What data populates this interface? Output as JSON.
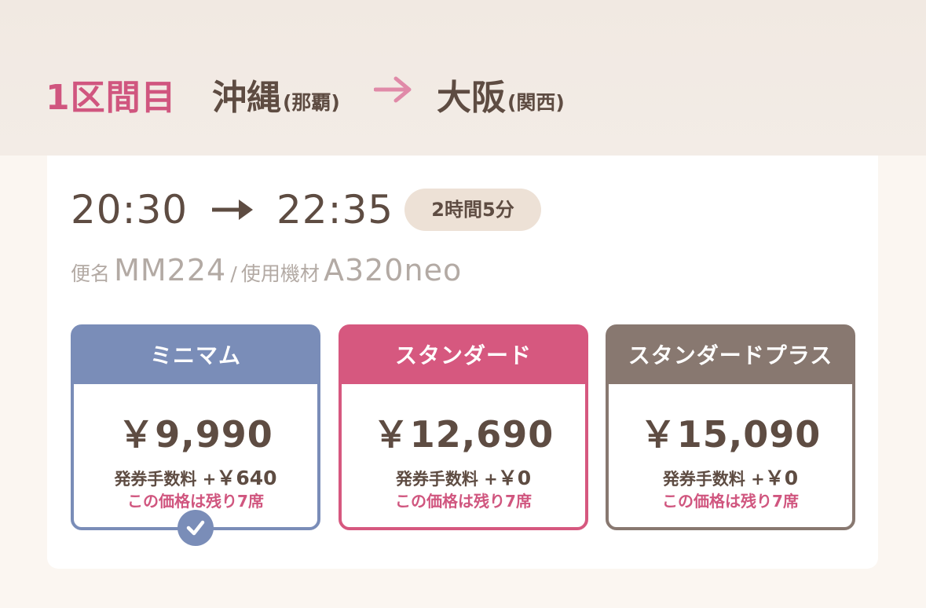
{
  "header": {
    "segment_label": "1区間目",
    "origin_city": "沖縄",
    "origin_airport": "(那覇)",
    "destination_city": "大阪",
    "destination_airport": "(関西)"
  },
  "flight": {
    "departure_time": "20:30",
    "arrival_time": "22:35",
    "duration": "2時間5分",
    "flight_no_label": "便名",
    "flight_no": "MM224",
    "separator": "/",
    "aircraft_label": "使用機材",
    "aircraft": "A320neo"
  },
  "fares": [
    {
      "name": "ミニマム",
      "price": "￥9,990",
      "fee_label": "発券手数料 +",
      "fee": "￥640",
      "seats": "この価格は残り7席",
      "color": "#7a8db8",
      "selected": true
    },
    {
      "name": "スタンダード",
      "price": "￥12,690",
      "fee_label": "発券手数料 +",
      "fee": "￥0",
      "seats": "この価格は残り7席",
      "color": "#d6587f",
      "selected": false
    },
    {
      "name": "スタンダードプラス",
      "price": "￥15,090",
      "fee_label": "発券手数料 +",
      "fee": "￥0",
      "seats": "この価格は残り7席",
      "color": "#887870",
      "selected": false
    }
  ],
  "icons": {
    "route_arrow": "arrow-right-icon",
    "time_arrow": "arrow-right-icon",
    "selected_mark": "check-circle-icon"
  },
  "colors": {
    "accent_pink": "#d0567f",
    "text_brown": "#5e4c42",
    "muted_gray": "#b3aaa4"
  }
}
